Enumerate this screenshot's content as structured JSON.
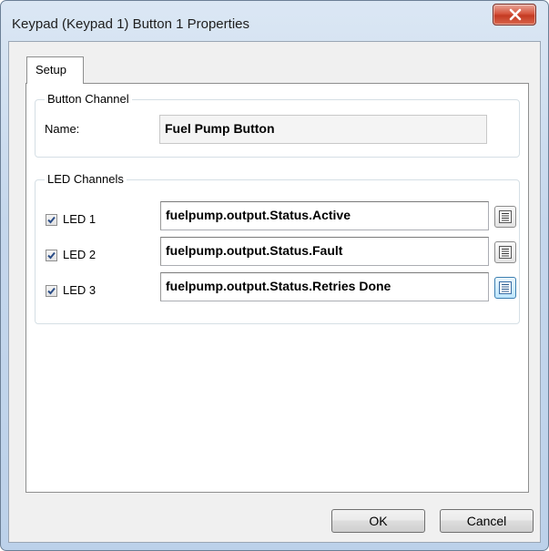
{
  "window": {
    "title": "Keypad (Keypad 1) Button 1 Properties"
  },
  "tabs": [
    {
      "label": "Setup",
      "selected": true
    }
  ],
  "button_channel": {
    "legend": "Button Channel",
    "name_label": "Name:",
    "name_value": "Fuel Pump Button"
  },
  "led_channels": {
    "legend": "LED Channels",
    "leds": [
      {
        "label": "LED 1",
        "checked": true,
        "value": "fuelpump.output.Status.Active"
      },
      {
        "label": "LED 2",
        "checked": true,
        "value": "fuelpump.output.Status.Fault"
      },
      {
        "label": "LED 3",
        "checked": true,
        "value": "fuelpump.output.Status.Retries Done"
      }
    ]
  },
  "buttons": {
    "ok": "OK",
    "cancel": "Cancel"
  },
  "icons": {
    "close": "close-icon",
    "browse": "list-icon",
    "check": "checkmark-icon"
  }
}
